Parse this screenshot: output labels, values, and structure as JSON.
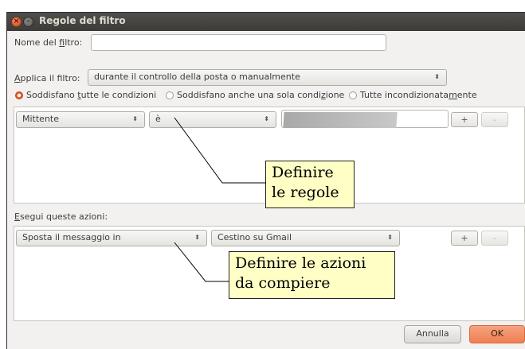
{
  "window": {
    "title": "Regole del filtro",
    "close_glyph": "×",
    "minimize_glyph": "–"
  },
  "filter_name": {
    "label_prefix": "Nome del ",
    "label_underlined": "f",
    "label_suffix": "iltro:",
    "value": ""
  },
  "apply_filter": {
    "label_prefix": "",
    "label_underlined": "A",
    "label_suffix": "pplica il filtro:",
    "selected": "durante il controllo della posta o manualmente"
  },
  "match_options": [
    {
      "prefix": "Soddisfano ",
      "underlined": "t",
      "suffix": "utte le condizioni",
      "checked": true
    },
    {
      "prefix": "Soddisfano anche una sola condi",
      "underlined": "z",
      "suffix": "ione",
      "checked": false
    },
    {
      "prefix": "Tutte incondizionata",
      "underlined": "m",
      "suffix": "ente",
      "checked": false
    }
  ],
  "rule_row": {
    "field": "Mittente",
    "operator": "è",
    "value": "",
    "add_label": "+",
    "remove_label": "–"
  },
  "actions": {
    "label_prefix": "",
    "label_underlined": "E",
    "label_suffix": "segui queste azioni:",
    "action": "Sposta il messaggio in",
    "target": "Cestino su Gmail",
    "add_label": "+",
    "remove_label": "–"
  },
  "callouts": {
    "rules": [
      "Definire",
      "le regole"
    ],
    "actions": [
      "Definire le azioni",
      "da compiere"
    ]
  },
  "footer": {
    "cancel_label": "Annulla",
    "ok_label": "OK"
  },
  "colors": {
    "accent": "#e05a27",
    "titlebar": "#3c3b37",
    "callout_bg": "#ffffc5"
  }
}
